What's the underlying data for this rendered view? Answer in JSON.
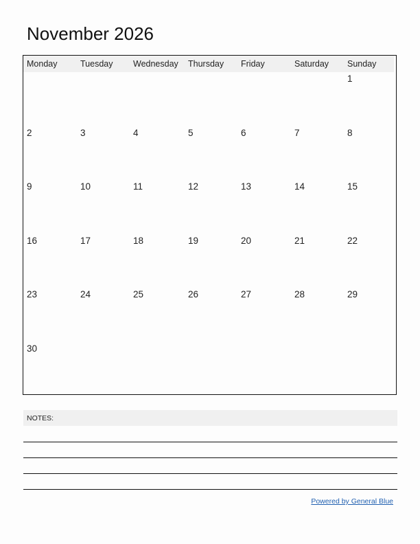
{
  "title": "November 2026",
  "weekdays": [
    "Monday",
    "Tuesday",
    "Wednesday",
    "Thursday",
    "Friday",
    "Saturday",
    "Sunday"
  ],
  "weeks": [
    [
      "",
      "",
      "",
      "",
      "",
      "",
      "1"
    ],
    [
      "2",
      "3",
      "4",
      "5",
      "6",
      "7",
      "8"
    ],
    [
      "9",
      "10",
      "11",
      "12",
      "13",
      "14",
      "15"
    ],
    [
      "16",
      "17",
      "18",
      "19",
      "20",
      "21",
      "22"
    ],
    [
      "23",
      "24",
      "25",
      "26",
      "27",
      "28",
      "29"
    ],
    [
      "30",
      "",
      "",
      "",
      "",
      "",
      ""
    ]
  ],
  "notes": {
    "label": "NOTES:",
    "line_count": 4
  },
  "footer": {
    "powered_by": "Powered by General Blue"
  },
  "colors": {
    "header_bg": "#f0f0f0",
    "link": "#1f5fb0"
  }
}
